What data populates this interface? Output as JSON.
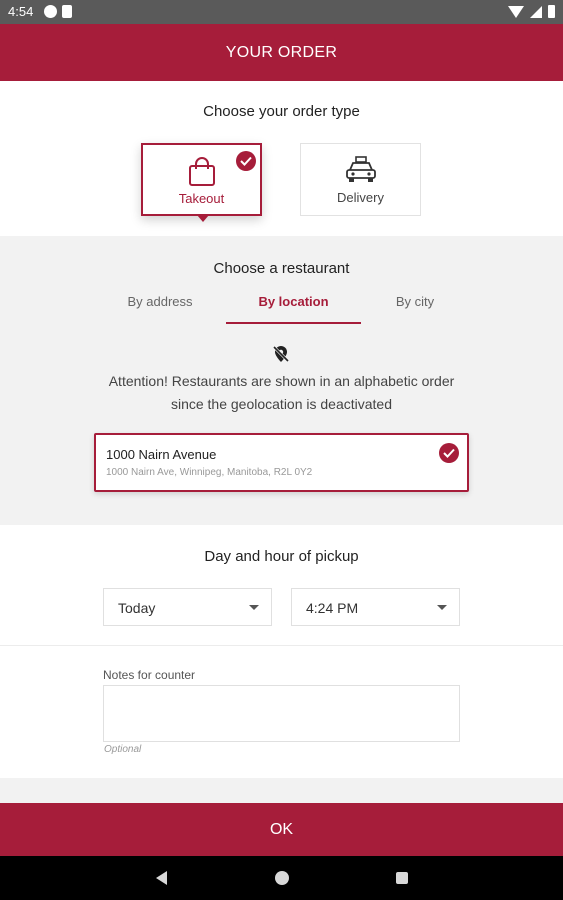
{
  "status_bar": {
    "time": "4:54",
    "left_icons": [
      "notification-p-icon",
      "sd-card-icon"
    ],
    "right_icons": [
      "wifi-icon",
      "signal-icon",
      "battery-icon"
    ]
  },
  "app_bar": {
    "title": "YOUR ORDER"
  },
  "order_type": {
    "title": "Choose your order type",
    "options": [
      {
        "label": "Takeout",
        "icon": "shopping-bag-icon",
        "selected": true
      },
      {
        "label": "Delivery",
        "icon": "car-icon",
        "selected": false
      }
    ]
  },
  "restaurant": {
    "title": "Choose a restaurant",
    "tabs": [
      {
        "label": "By address",
        "active": false
      },
      {
        "label": "By location",
        "active": true
      },
      {
        "label": "By city",
        "active": false
      }
    ],
    "geo_icon": "location-off-icon",
    "attention_line1": "Attention! Restaurants are shown in an alphabetic order",
    "attention_line2": "since the geolocation is deactivated",
    "selected_restaurant": {
      "name": "1000 Nairn Avenue",
      "address": "1000 Nairn Ave, Winnipeg, Manitoba, R2L 0Y2",
      "selected": true
    }
  },
  "pickup": {
    "title": "Day and hour of pickup",
    "day": "Today",
    "hour": "4:24 PM"
  },
  "notes": {
    "label": "Notes for counter",
    "value": "",
    "hint": "Optional"
  },
  "ok_button": {
    "label": "OK"
  },
  "colors": {
    "brand": "#a61d3a",
    "section_bg": "#f2f2f2"
  }
}
